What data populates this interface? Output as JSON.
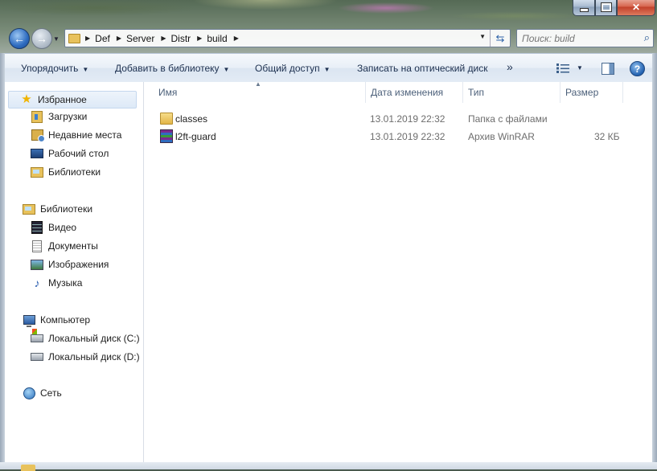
{
  "window": {
    "controls": {
      "minimize": "minimize",
      "maximize": "maximize",
      "close": "close"
    }
  },
  "address": {
    "crumbs": [
      "Def",
      "Server",
      "Distr",
      "build"
    ]
  },
  "search": {
    "placeholder": "Поиск: build"
  },
  "toolbar": {
    "organize": "Упорядочить",
    "add_library": "Добавить в библиотеку",
    "share": "Общий доступ",
    "burn": "Записать на оптический диск",
    "more": "»"
  },
  "sidebar": {
    "favorites": {
      "label": "Избранное",
      "items": [
        "Загрузки",
        "Недавние места",
        "Рабочий стол",
        "Библиотеки"
      ]
    },
    "libraries": {
      "label": "Библиотеки",
      "items": [
        "Видео",
        "Документы",
        "Изображения",
        "Музыка"
      ]
    },
    "computer": {
      "label": "Компьютер",
      "items": [
        "Локальный диск (C:)",
        "Локальный диск (D:)"
      ]
    },
    "network": {
      "label": "Сеть"
    }
  },
  "columns": {
    "name": "Имя",
    "date": "Дата изменения",
    "type": "Тип",
    "size": "Размер"
  },
  "files": [
    {
      "name": "classes",
      "date": "13.01.2019 22:32",
      "type": "Папка с файлами",
      "size": "",
      "icon": "folder-icon"
    },
    {
      "name": "l2ft-guard",
      "date": "13.01.2019 22:32",
      "type": "Архив WinRAR",
      "size": "32 КБ",
      "icon": "winrar-archive-icon"
    }
  ],
  "colors": {
    "accent": "#2d6bbf",
    "selection": "#dde9f7"
  }
}
